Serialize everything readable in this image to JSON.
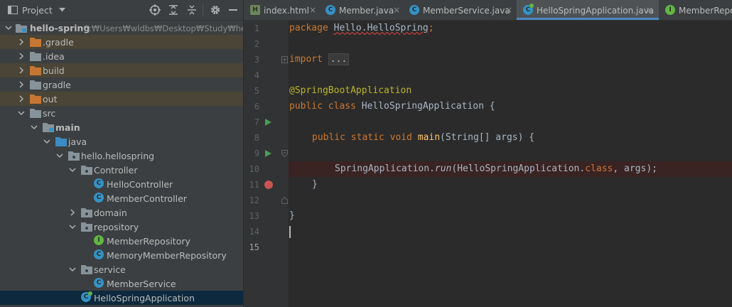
{
  "project_panel": {
    "title": "Project",
    "root": {
      "name": "hello-spring",
      "path": "C:₩Users₩wldbs₩Desktop₩Study₩hello-s"
    },
    "items": [
      {
        "label": ".gradle",
        "kind": "folder-orange"
      },
      {
        "label": ".idea",
        "kind": "folder"
      },
      {
        "label": "build",
        "kind": "folder-orange"
      },
      {
        "label": "gradle",
        "kind": "folder"
      },
      {
        "label": "out",
        "kind": "folder-orange"
      },
      {
        "label": "src",
        "kind": "folder"
      },
      {
        "label": "main",
        "kind": "folder"
      },
      {
        "label": "java",
        "kind": "source-folder"
      },
      {
        "label": "hello.hellospring",
        "kind": "package"
      },
      {
        "label": "Controller",
        "kind": "package"
      },
      {
        "label": "HelloController",
        "kind": "class"
      },
      {
        "label": "MemberController",
        "kind": "class"
      },
      {
        "label": "domain",
        "kind": "package"
      },
      {
        "label": "repository",
        "kind": "package"
      },
      {
        "label": "MemberRepository",
        "kind": "interface"
      },
      {
        "label": "MemoryMemberRepository",
        "kind": "class"
      },
      {
        "label": "service",
        "kind": "package"
      },
      {
        "label": "MemberService",
        "kind": "class"
      },
      {
        "label": "HelloSpringApplication",
        "kind": "spring-boot-class"
      }
    ]
  },
  "tabs": [
    {
      "label": "index.html",
      "icon": "html-file-icon",
      "letter": "H"
    },
    {
      "label": "Member.java",
      "icon": "class-icon",
      "letter": "C"
    },
    {
      "label": "MemberService.java",
      "icon": "class-icon",
      "letter": "C"
    },
    {
      "label": "HelloSpringApplication.java",
      "icon": "spring-boot-class-icon",
      "letter": "C"
    },
    {
      "label": "MemberRepos",
      "icon": "interface-icon",
      "letter": "I"
    }
  ],
  "tab_close_glyph": "×",
  "editor": {
    "line_numbers": [
      "1",
      "2",
      "3",
      "4",
      "5",
      "6",
      "7",
      "8",
      "9",
      "10",
      "11",
      "12",
      "13",
      "14",
      "15"
    ],
    "code": {
      "l1_kw": "package ",
      "l1_pkg": "Hello.HelloSpring",
      "l1_semi": ";",
      "l3_kw": "import ",
      "l3_fold": "...",
      "l6_ann": "@SpringBootApplication",
      "l7_kw": "public class ",
      "l7_name": "HelloSpringApplication {",
      "l9_kw": "public static void ",
      "l9_fn": "main",
      "l9_rest": "(String[] args) {",
      "l11_a": "SpringApplication.",
      "l11_run": "run",
      "l11_b": "(HelloSpringApplication.",
      "l11_class": "class",
      "l11_c": ", args);",
      "l12": "}",
      "l14": "}"
    }
  },
  "colors": {
    "panel_bg": "#3c3f41",
    "editor_bg": "#2b2b2b",
    "keyword": "#cc7832",
    "annotation": "#bbb529",
    "method": "#ffc66d",
    "identifier": "#a9b7c6",
    "breakpoint": "#c75450",
    "run": "#499c54",
    "selection": "#0d293e",
    "excluded_folder_bg": "#4a4536",
    "active_tab_accent": "#4a88c7"
  }
}
